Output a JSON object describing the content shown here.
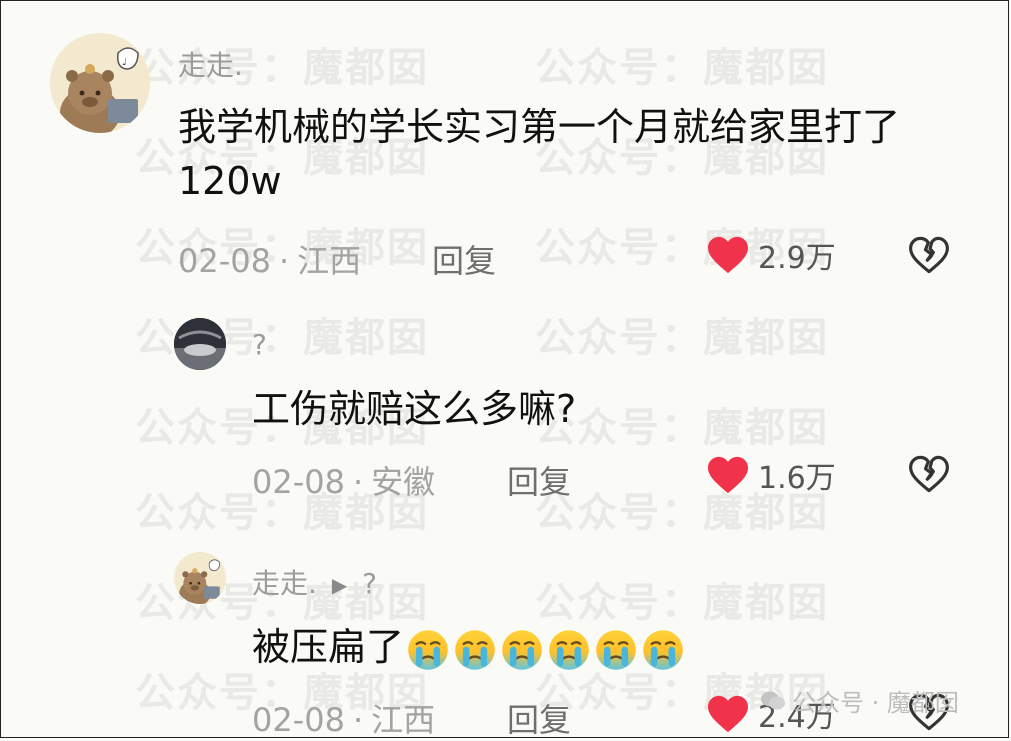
{
  "watermark": "公众号：魔都囡",
  "brand_tag": "公众号 · 魔都囡",
  "comments": [
    {
      "username": "走走.",
      "text": "我学机械的学长实习第一个月就给家里打了120w",
      "date": "02-08",
      "location": "江西",
      "reply_label": "回复",
      "likes": "2.9万"
    },
    {
      "username": "?",
      "text": "工伤就赔这么多嘛?",
      "date": "02-08",
      "location": "安徽",
      "reply_label": "回复",
      "likes": "1.6万"
    },
    {
      "username": "走走.",
      "reply_to": "?",
      "text": "被压扁了",
      "emoji": "crying-face",
      "emoji_count": 6,
      "date": "02-08",
      "location": "江西",
      "reply_label": "回复",
      "likes": "2.4万"
    }
  ],
  "colors": {
    "heart": "#f0324a",
    "text": "#111111",
    "meta": "#a3a3a3"
  }
}
